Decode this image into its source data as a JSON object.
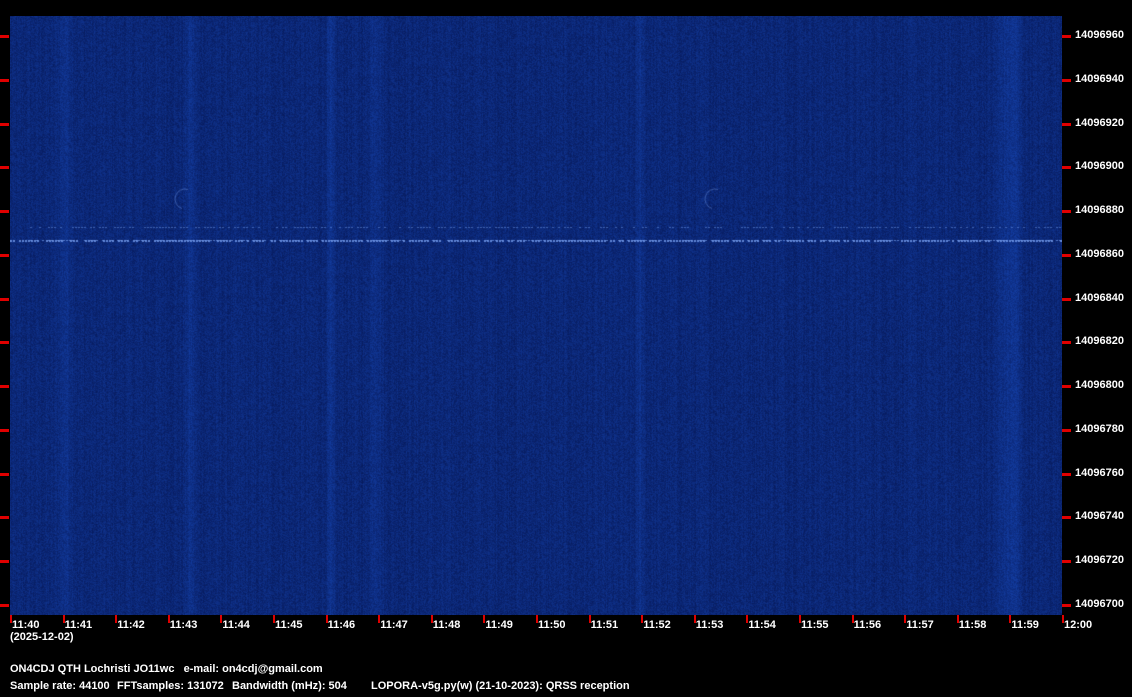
{
  "spectrogram": {
    "frequencies": [
      "14096960",
      "14096940",
      "14096920",
      "14096900",
      "14096880",
      "14096860",
      "14096840",
      "14096820",
      "14096800",
      "14096780",
      "14096760",
      "14096740",
      "14096720",
      "14096700"
    ],
    "times": [
      "11:40",
      "11:41",
      "11:42",
      "11:43",
      "11:44",
      "11:45",
      "11:46",
      "11:47",
      "11:48",
      "11:49",
      "11:50",
      "11:51",
      "11:52",
      "11:53",
      "11:54",
      "11:55",
      "11:56",
      "11:57",
      "11:58",
      "11:59",
      "12:00"
    ],
    "date": "(2025-12-02)",
    "background_color": "#0a2266",
    "tick_color": "#e00000"
  },
  "footer": {
    "station": "ON4CDJ QTH Lochristi JO11wc   e-mail: on4cdj@gmail.com",
    "sample_rate": "Sample rate: 44100",
    "fft_samples": "FFTsamples: 131072",
    "bandwidth": "Bandwidth (mHz): 504",
    "software": "LOPORA-v5g.py(w) (21-10-2023): QRSS reception"
  }
}
